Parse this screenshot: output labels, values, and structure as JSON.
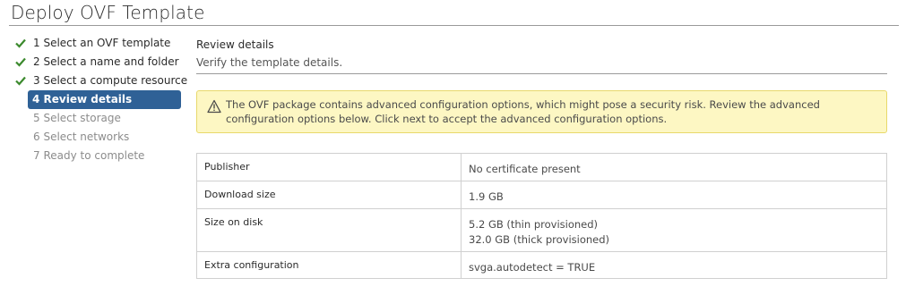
{
  "window": {
    "title": "Deploy OVF Template"
  },
  "steps": [
    {
      "label": "1 Select an OVF template",
      "state": "done"
    },
    {
      "label": "2 Select a name and folder",
      "state": "done"
    },
    {
      "label": "3 Select a compute resource",
      "state": "done"
    },
    {
      "label": "4 Review details",
      "state": "active"
    },
    {
      "label": "5 Select storage",
      "state": "pending"
    },
    {
      "label": "6 Select networks",
      "state": "pending"
    },
    {
      "label": "7 Ready to complete",
      "state": "pending"
    }
  ],
  "main": {
    "title": "Review details",
    "subtitle": "Verify the template details.",
    "warning": "The OVF package contains advanced configuration options, which might pose a security risk. Review the advanced configuration options below. Click next to accept the advanced configuration options.",
    "details": [
      {
        "key": "Publisher",
        "values": [
          "No certificate present"
        ]
      },
      {
        "key": "Download size",
        "values": [
          "1.9 GB"
        ]
      },
      {
        "key": "Size on disk",
        "values": [
          "5.2 GB (thin provisioned)",
          "32.0 GB (thick provisioned)"
        ]
      },
      {
        "key": "Extra configuration",
        "values": [
          "svga.autodetect = TRUE"
        ]
      }
    ]
  },
  "icons": {
    "done": "checkmark-icon",
    "warning": "warning-triangle-icon"
  },
  "colors": {
    "accent": "#2f6196",
    "check": "#3c8a2e",
    "warning_bg": "#fdf7c3"
  }
}
